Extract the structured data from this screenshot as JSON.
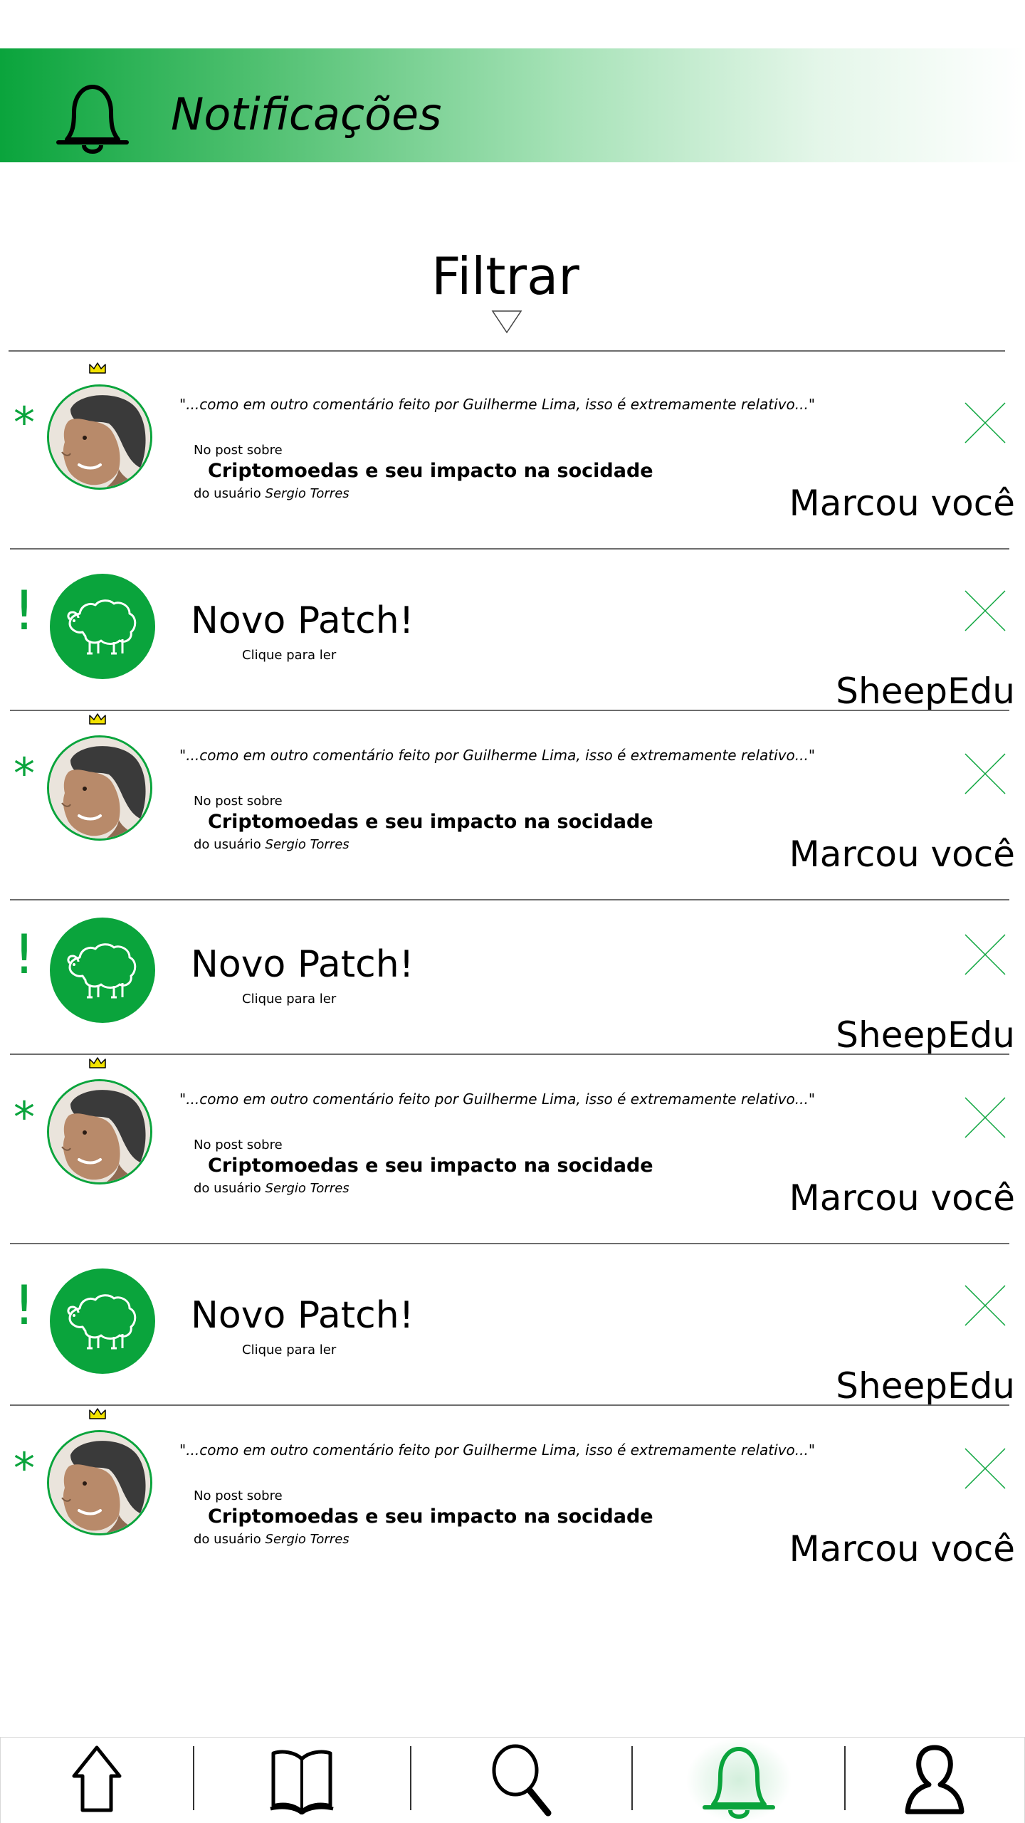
{
  "header": {
    "title": "Notificações"
  },
  "filter": {
    "label": "Filtrar"
  },
  "notifications": [
    {
      "type": "mention",
      "marker": "*",
      "quote": "\"...como em outro comentário feito por Guilherme Lima, isso é extremamente relativo...\"",
      "post_prefix": "No post sobre",
      "post_title": "Criptomoedas e seu impacto na socidade",
      "by_prefix": "do usuário",
      "by_user": "Sergio Torres",
      "action": "Marcou você"
    },
    {
      "type": "patch",
      "marker": "!",
      "title": "Novo Patch!",
      "subtitle": "Clique para ler",
      "source": "SheepEdu"
    },
    {
      "type": "mention",
      "marker": "*",
      "quote": "\"...como em outro comentário feito por Guilherme Lima, isso é extremamente relativo...\"",
      "post_prefix": "No post sobre",
      "post_title": "Criptomoedas e seu impacto na socidade",
      "by_prefix": "do usuário",
      "by_user": "Sergio Torres",
      "action": "Marcou você"
    },
    {
      "type": "patch",
      "marker": "!",
      "title": "Novo Patch!",
      "subtitle": "Clique para ler",
      "source": "SheepEdu"
    },
    {
      "type": "mention",
      "marker": "*",
      "quote": "\"...como em outro comentário feito por Guilherme Lima, isso é extremamente relativo...\"",
      "post_prefix": "No post sobre",
      "post_title": "Criptomoedas e seu impacto na socidade",
      "by_prefix": "do usuário",
      "by_user": "Sergio Torres",
      "action": "Marcou você"
    },
    {
      "type": "patch",
      "marker": "!",
      "title": "Novo Patch!",
      "subtitle": "Clique para ler",
      "source": "SheepEdu"
    },
    {
      "type": "mention",
      "marker": "*",
      "quote": "\"...como em outro comentário feito por Guilherme Lima, isso é extremamente relativo...\"",
      "post_prefix": "No post sobre",
      "post_title": "Criptomoedas e seu impacto na socidade",
      "by_prefix": "do usuário",
      "by_user": "Sergio Torres",
      "action": "Marcou você"
    }
  ],
  "nav": {
    "items": [
      {
        "icon": "home-icon",
        "active": false
      },
      {
        "icon": "book-icon",
        "active": false
      },
      {
        "icon": "search-icon",
        "active": false
      },
      {
        "icon": "bell-icon",
        "active": true
      },
      {
        "icon": "profile-icon",
        "active": false
      }
    ]
  },
  "colors": {
    "accent": "#0aa43c",
    "crown": "#f2e200",
    "divider": "#6d6d6d"
  }
}
